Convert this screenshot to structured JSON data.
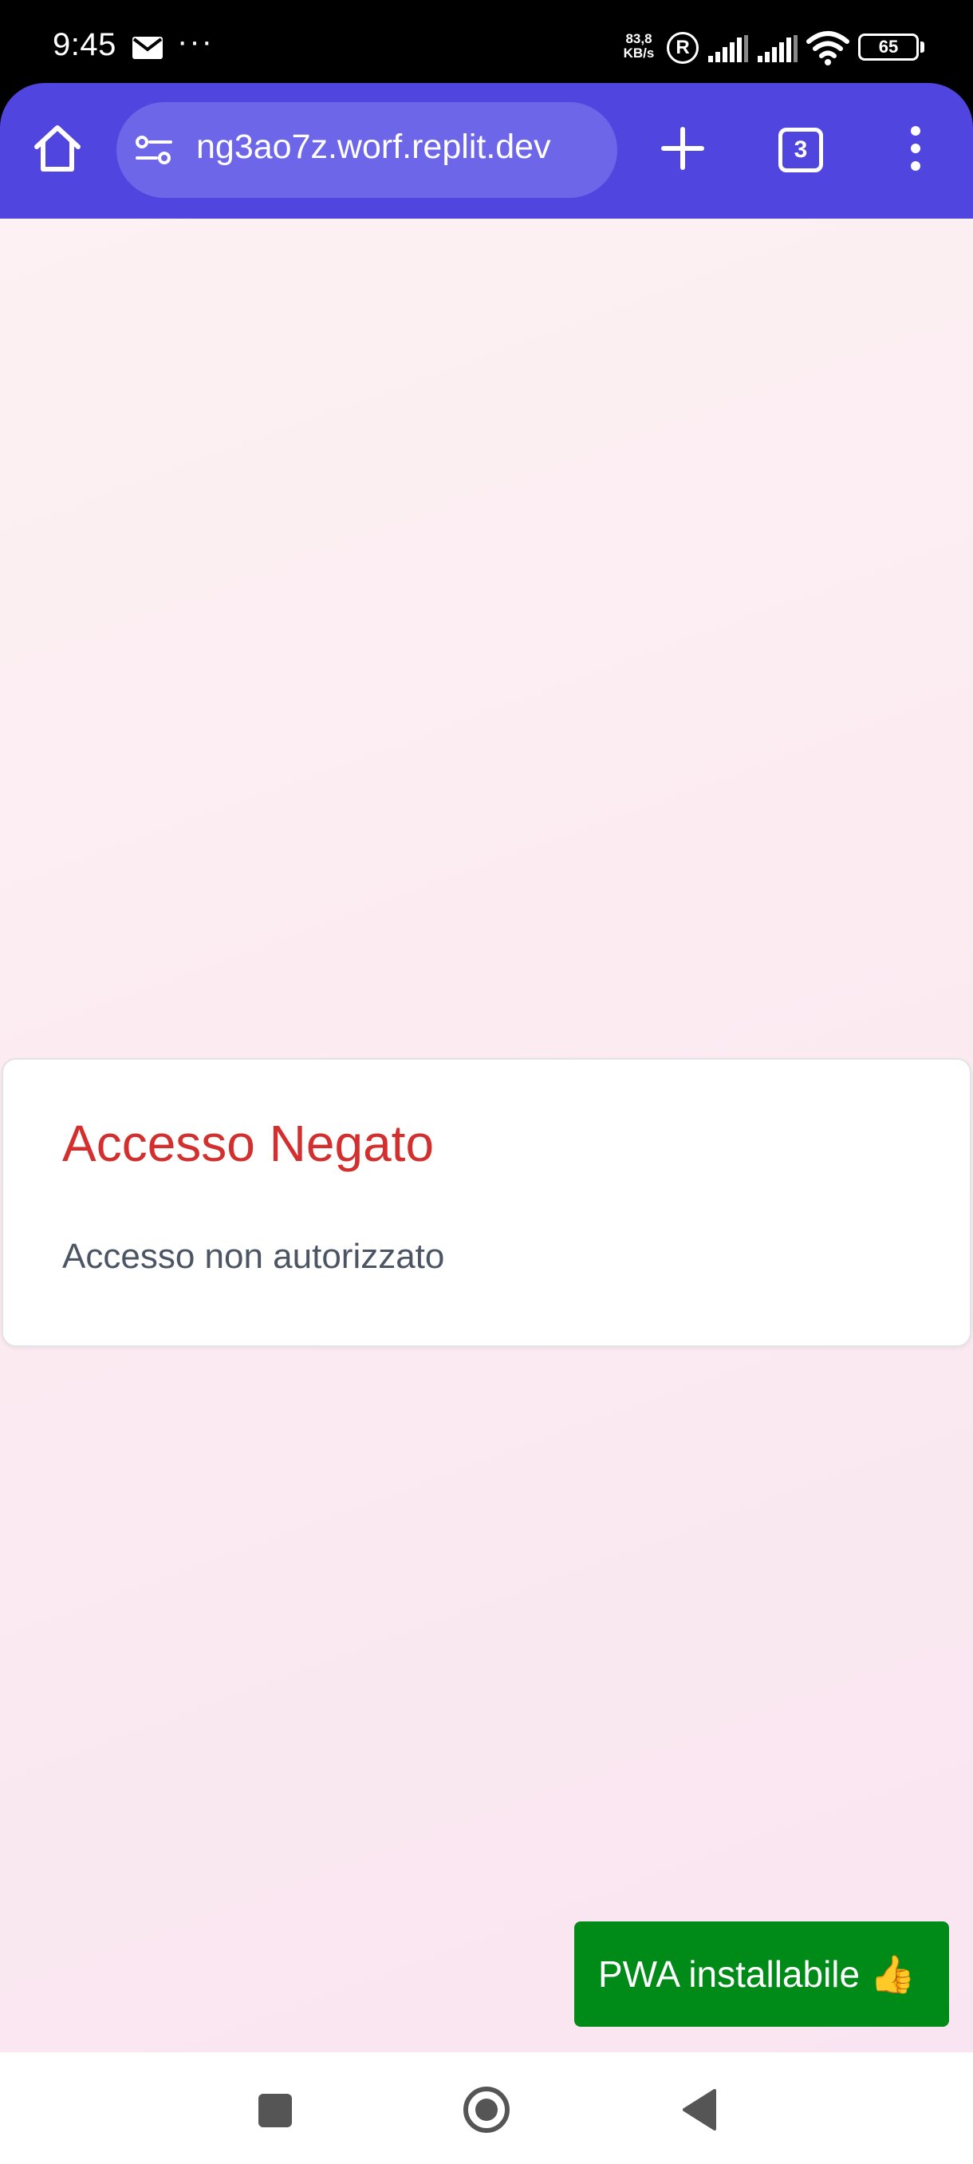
{
  "status_bar": {
    "time": "9:45",
    "more_indicator": "···",
    "net_speed_value": "83,8",
    "net_speed_unit": "KB/s",
    "roaming_badge": "R",
    "battery_level": "65",
    "icons": [
      "mail-icon",
      "signal-icon",
      "wifi-icon",
      "battery-icon"
    ]
  },
  "browser": {
    "url": "ng3ao7z.worf.replit.dev",
    "tab_count": "3",
    "accent_color": "#5145e0",
    "icons": [
      "home-icon",
      "tune-icon",
      "plus-icon",
      "more-vert-icon"
    ]
  },
  "card": {
    "title": "Accesso Negato",
    "message": "Accesso non autorizzato",
    "title_color": "#d32f2f"
  },
  "toast": {
    "text": "PWA installabile 👍",
    "color": "#008a17"
  },
  "nav_bar": {
    "icons": [
      "recents-icon",
      "home-circle-icon",
      "back-icon"
    ]
  }
}
